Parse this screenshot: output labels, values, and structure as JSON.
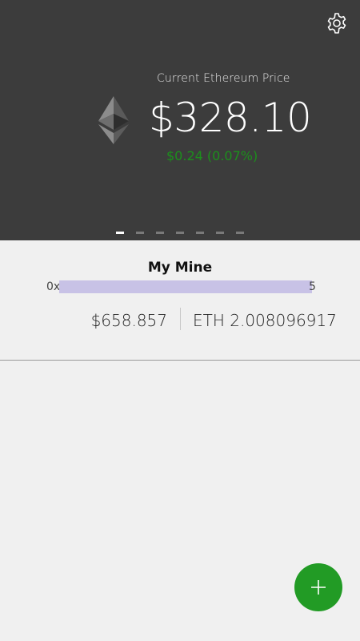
{
  "header": {
    "settings_icon": "gear-icon",
    "logo_icon": "ethereum-logo-icon",
    "price_label": "Current Ethereum Price",
    "price_value": "$328.10",
    "price_change": "$0.24  (0.07%)",
    "price_change_color": "#1c8f1c"
  },
  "pager": {
    "count": 7,
    "active_index": 0
  },
  "wallet": {
    "name": "My Mine",
    "address_prefix": "0x",
    "address_suffix": "5",
    "balance_usd": "$658.857",
    "balance_eth": "ETH 2.008096917"
  },
  "fab": {
    "icon": "plus-icon",
    "color": "#229b25"
  }
}
